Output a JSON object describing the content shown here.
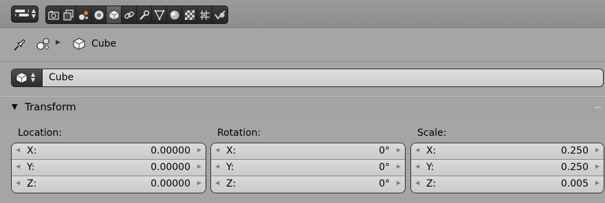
{
  "properties_tabs": [
    {
      "name": "render-icon",
      "active": false
    },
    {
      "name": "render-layers-icon",
      "active": false
    },
    {
      "name": "scene-icon",
      "active": false
    },
    {
      "name": "world-icon",
      "active": false
    },
    {
      "name": "object-icon",
      "active": true
    },
    {
      "name": "constraints-icon",
      "active": false
    },
    {
      "name": "modifiers-icon",
      "active": false
    },
    {
      "name": "data-icon",
      "active": false
    },
    {
      "name": "material-icon",
      "active": false
    },
    {
      "name": "texture-icon",
      "active": false
    },
    {
      "name": "particles-icon",
      "active": false
    },
    {
      "name": "physics-icon",
      "active": false
    }
  ],
  "breadcrumb": {
    "object_name": "Cube"
  },
  "object_field": {
    "value": "Cube"
  },
  "transform": {
    "title": "Transform",
    "location": {
      "label": "Location:",
      "x_label": "X:",
      "x": "0.00000",
      "y_label": "Y:",
      "y": "0.00000",
      "z_label": "Z:",
      "z": "0.00000"
    },
    "rotation": {
      "label": "Rotation:",
      "x_label": "X:",
      "x": "0°",
      "y_label": "Y:",
      "y": "0°",
      "z_label": "Z:",
      "z": "0°"
    },
    "scale": {
      "label": "Scale:",
      "x_label": "X:",
      "x": "0.250",
      "y_label": "Y:",
      "y": "0.250",
      "z_label": "Z:",
      "z": "0.005"
    }
  },
  "colors": {
    "background": "#a5a5a5",
    "tab_bar": "#3c3c3c",
    "field": "#d2d2d2"
  }
}
